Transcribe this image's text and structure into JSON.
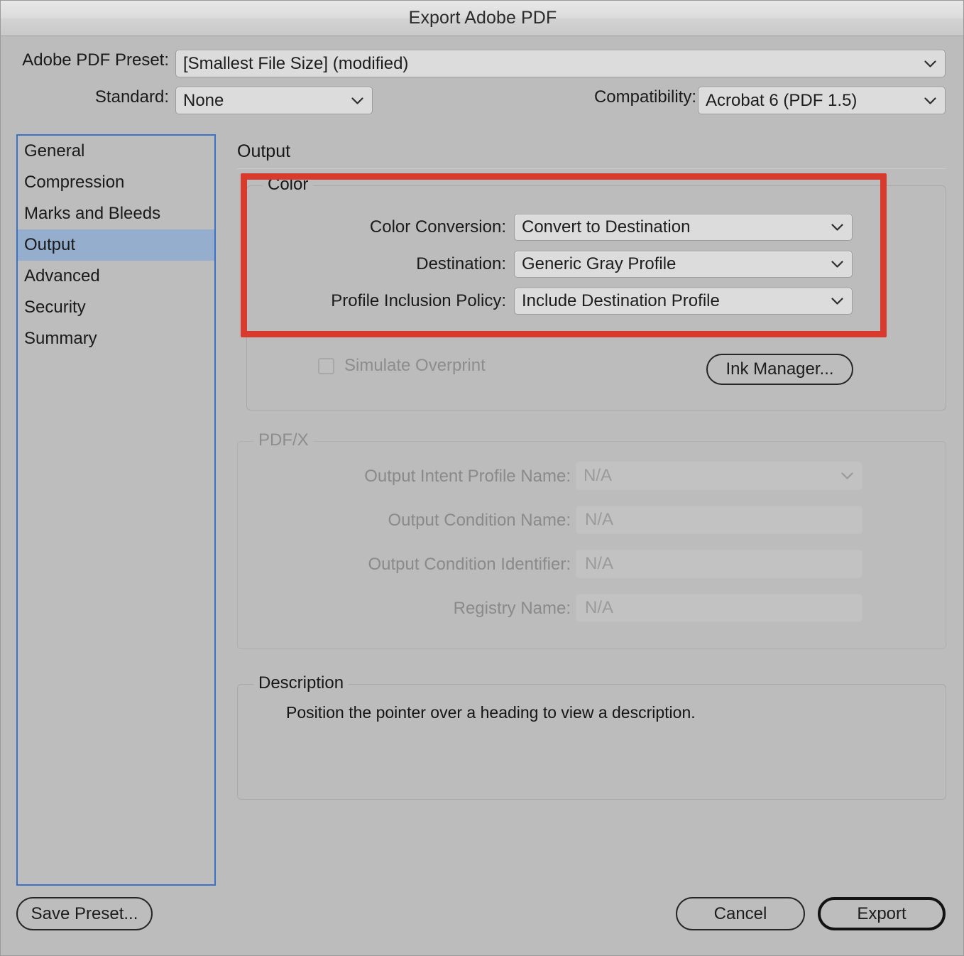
{
  "window": {
    "title": "Export Adobe PDF"
  },
  "top": {
    "preset_label": "Adobe PDF Preset:",
    "preset_value": "[Smallest File Size] (modified)",
    "standard_label": "Standard:",
    "standard_value": "None",
    "compatibility_label": "Compatibility:",
    "compatibility_value": "Acrobat 6 (PDF 1.5)"
  },
  "sidebar": {
    "items": [
      {
        "label": "General",
        "selected": false
      },
      {
        "label": "Compression",
        "selected": false
      },
      {
        "label": "Marks and Bleeds",
        "selected": false
      },
      {
        "label": "Output",
        "selected": true
      },
      {
        "label": "Advanced",
        "selected": false
      },
      {
        "label": "Security",
        "selected": false
      },
      {
        "label": "Summary",
        "selected": false
      }
    ]
  },
  "pane": {
    "title": "Output"
  },
  "color_group": {
    "legend": "Color",
    "rows": [
      {
        "label": "Color Conversion:",
        "value": "Convert to Destination"
      },
      {
        "label": "Destination:",
        "value": "Generic Gray Profile"
      },
      {
        "label": "Profile Inclusion Policy:",
        "value": "Include Destination Profile"
      }
    ],
    "simulate_overprint_label": "Simulate Overprint",
    "ink_manager_label": "Ink Manager..."
  },
  "pdfx_group": {
    "legend": "PDF/X",
    "rows": [
      {
        "label": "Output Intent Profile Name:",
        "value": "N/A"
      },
      {
        "label": "Output Condition Name:",
        "value": "N/A"
      },
      {
        "label": "Output Condition Identifier:",
        "value": "N/A"
      },
      {
        "label": "Registry Name:",
        "value": "N/A"
      }
    ]
  },
  "description_group": {
    "legend": "Description",
    "text": "Position the pointer over a heading to view a description."
  },
  "footer": {
    "save_preset_label": "Save Preset...",
    "cancel_label": "Cancel",
    "export_label": "Export"
  },
  "annotation": {
    "highlight_color": "#d93a2e",
    "target": "color-group"
  },
  "colors": {
    "dialog_bg": "#bcbcbc",
    "selection_blue": "#95aece",
    "focus_border": "#3a72c8",
    "highlight_red": "#d93a2e"
  },
  "icons": {
    "chevron_down": "chevron-down-icon"
  }
}
